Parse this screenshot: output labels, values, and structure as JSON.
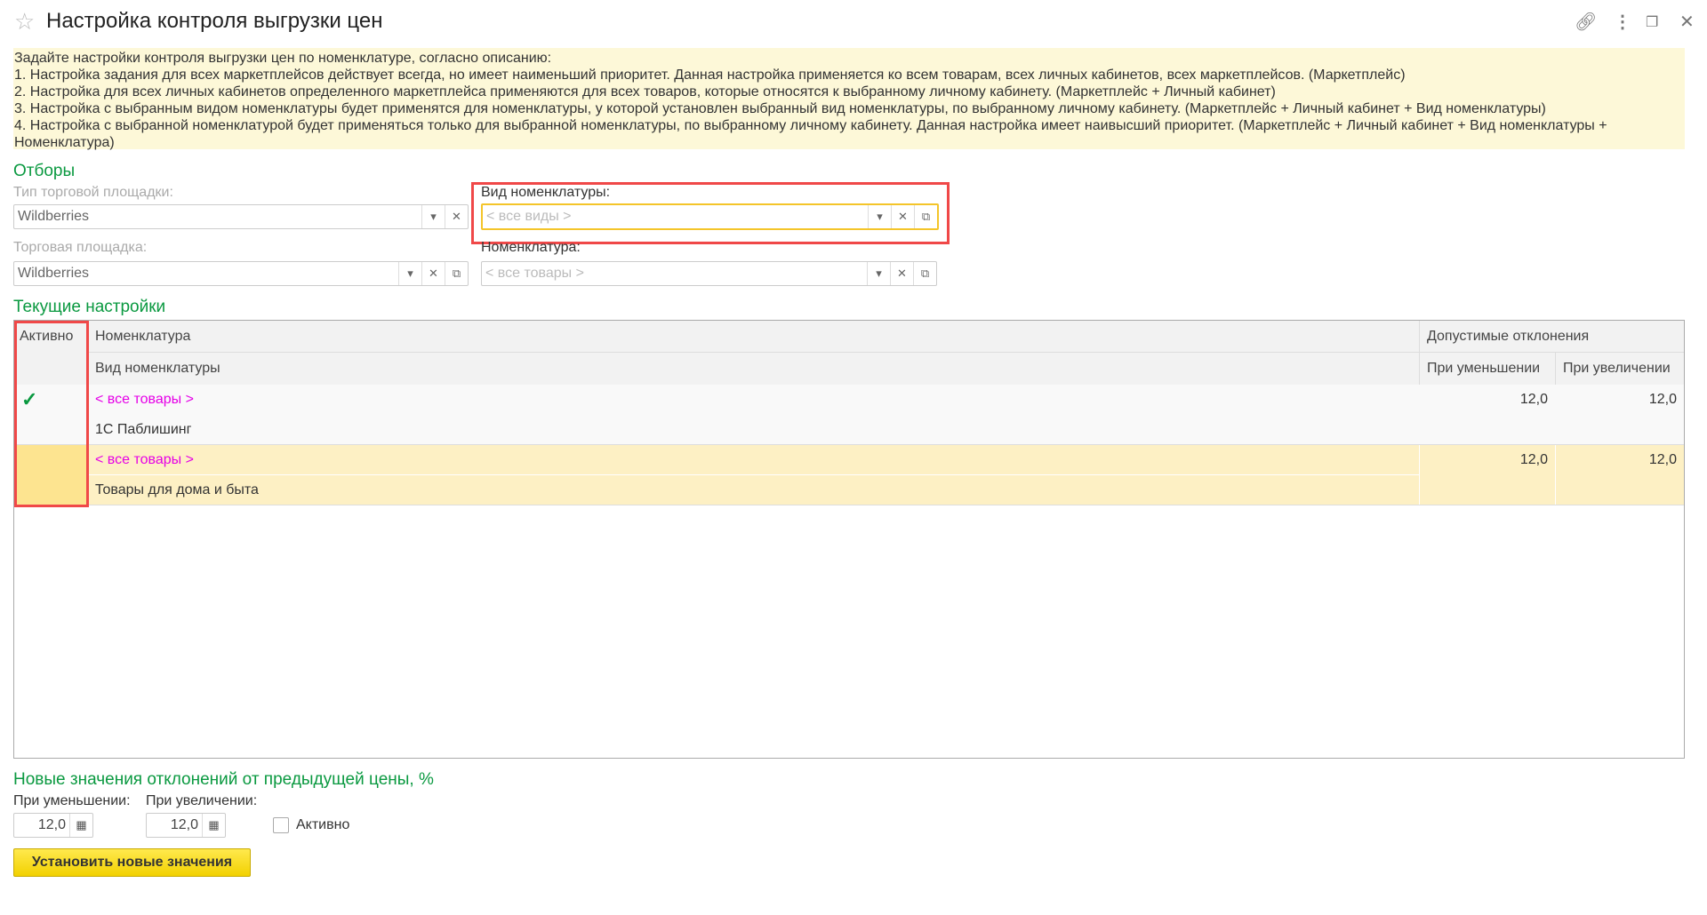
{
  "header": {
    "title": "Настройка контроля выгрузки цен"
  },
  "info": {
    "lines": [
      "Задайте настройки контроля выгрузки цен по номенклатуре, согласно описанию:",
      "1. Настройка задания для всех маркетплейсов действует всегда, но имеет наименьший приоритет. Данная настройка применяется ко всем товарам, всех личных кабинетов, всех маркетплейсов. (Маркетплейс)",
      "2. Настройка для всех личных кабинетов определенного маркетплейса применяются для всех товаров, которые относятся к выбранному личному кабинету. (Маркетплейс + Личный кабинет)",
      "3. Настройка с выбранным видом номенклатуры будет применятся для номенклатуры, у которой установлен выбранный вид номенклатуры, по выбранному личному кабинету. (Маркетплейс + Личный кабинет + Вид номенклатуры)",
      "4. Настройка с выбранной номенклатурой будет применяться только для выбранной номенклатуры, по выбранному личному кабинету. Данная настройка имеет наивысший приоритет. (Маркетплейс + Личный кабинет + Вид номенклатуры + Номенклатура)"
    ]
  },
  "filters": {
    "heading": "Отборы",
    "platform_type": {
      "label": "Тип торговой площадки:",
      "value": "Wildberries"
    },
    "platform": {
      "label": "Торговая площадка:",
      "value": "Wildberries"
    },
    "item_kind": {
      "label": "Вид номенклатуры:",
      "placeholder": "< все виды >"
    },
    "item": {
      "label": "Номенклатура:",
      "placeholder": "< все товары >"
    }
  },
  "table": {
    "heading": "Текущие настройки",
    "headers": {
      "active": "Активно",
      "item": "Номенклатура",
      "item_kind": "Вид номенклатуры",
      "deviations": "Допустимые отклонения",
      "decrease": "При уменьшении",
      "increase": "При увеличении"
    },
    "rows": [
      {
        "active": true,
        "item": "< все товары >",
        "item_kind": "1С Паблишинг",
        "decrease": "12,0",
        "increase": "12,0"
      },
      {
        "active": false,
        "item": "< все товары >",
        "item_kind": "Товары для дома и быта",
        "decrease": "12,0",
        "increase": "12,0"
      }
    ]
  },
  "new_values": {
    "heading": "Новые значения отклонений от предыдущей цены, %",
    "decrease_label": "При уменьшении:",
    "decrease_value": "12,0",
    "increase_label": "При увеличении:",
    "increase_value": "12,0",
    "active_label": "Активно",
    "button": "Установить новые значения"
  },
  "colors": {
    "accent_green": "#0a9940",
    "highlight": "#fdf0c4",
    "pink": "#e600e6"
  }
}
